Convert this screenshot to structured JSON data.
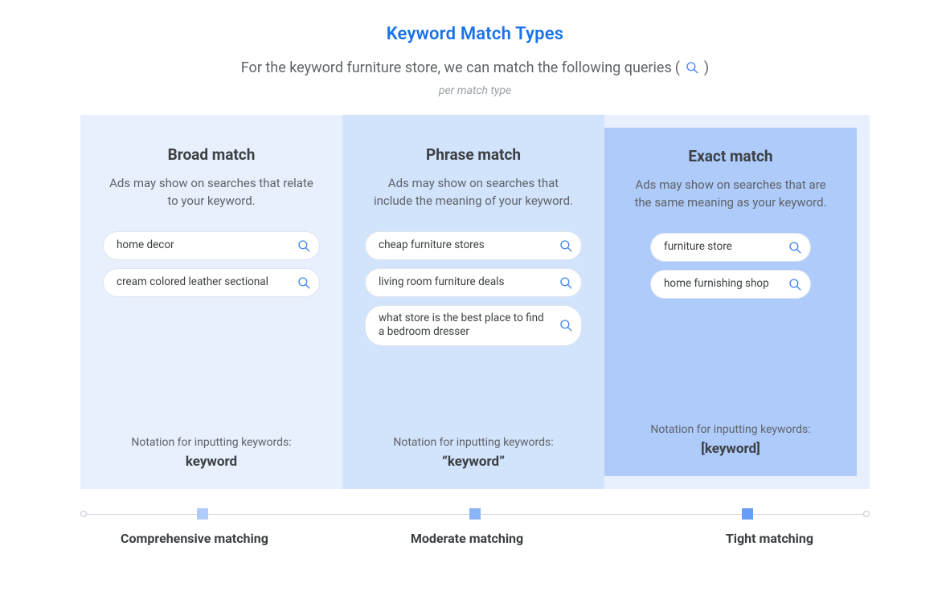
{
  "header": {
    "title": "Keyword Match Types",
    "subtitle_pre": "For the keyword furniture store, we can match the following queries",
    "subtitle_paren_open": "(",
    "subtitle_paren_close": ")",
    "per_match": "per match type"
  },
  "columns": {
    "broad": {
      "title": "Broad match",
      "desc": "Ads may show on searches that relate to your keyword.",
      "queries": [
        "home decor",
        "cream colored leather sectional"
      ],
      "notation_label": "Notation for inputting keywords:",
      "notation_value": "keyword"
    },
    "phrase": {
      "title": "Phrase match",
      "desc": "Ads may show on searches that include the meaning of your keyword.",
      "queries": [
        "cheap furniture stores",
        "living room furniture deals",
        "what store is the best place to find a bedroom dresser"
      ],
      "notation_label": "Notation for inputting keywords:",
      "notation_value": "“keyword”"
    },
    "exact": {
      "title": "Exact match",
      "desc": "Ads may show on searches that are the same meaning as your keyword.",
      "queries": [
        "furniture store",
        "home furnishing shop"
      ],
      "notation_label": "Notation for inputting keywords:",
      "notation_value": "[keyword]"
    }
  },
  "spectrum": {
    "labels": [
      "Comprehensive matching",
      "Moderate matching",
      "Tight matching"
    ]
  }
}
